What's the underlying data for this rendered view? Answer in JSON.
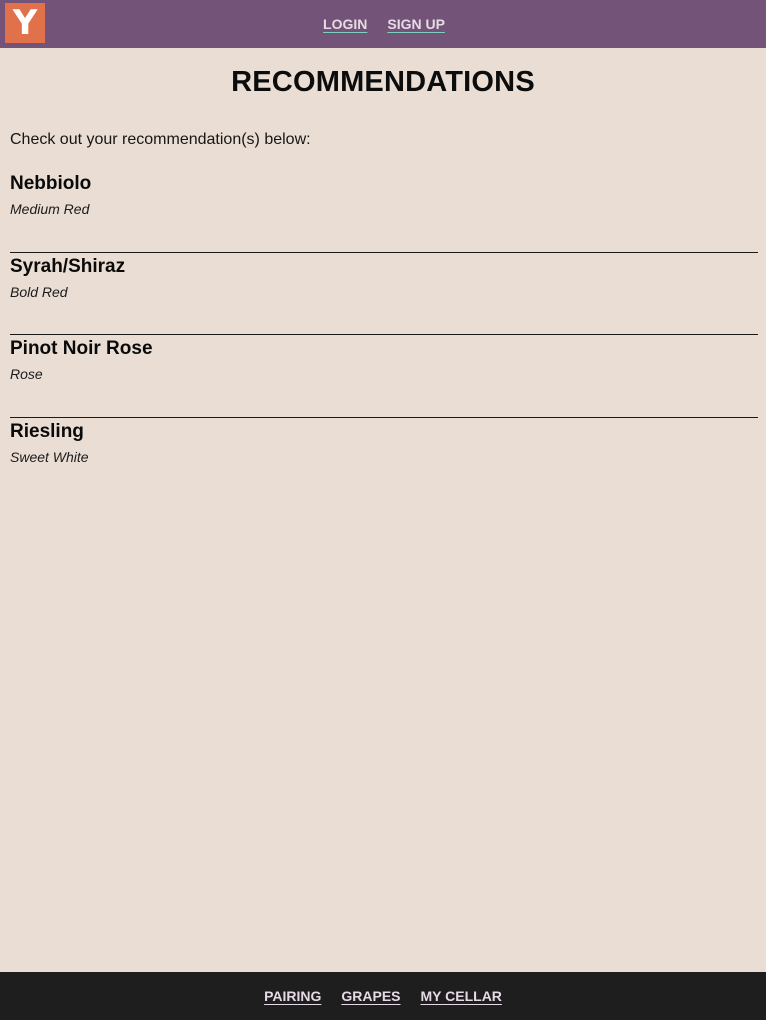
{
  "header": {
    "logo_letter": "Y",
    "nav": [
      {
        "label": "LOGIN"
      },
      {
        "label": "SIGN UP"
      }
    ]
  },
  "main": {
    "title": "RECOMMENDATIONS",
    "intro": "Check out your recommendation(s) below:",
    "recommendations": [
      {
        "name": "Nebbiolo",
        "type": "Medium Red"
      },
      {
        "name": "Syrah/Shiraz",
        "type": "Bold Red"
      },
      {
        "name": "Pinot Noir Rose",
        "type": "Rose"
      },
      {
        "name": "Riesling",
        "type": "Sweet White"
      }
    ]
  },
  "footer": {
    "nav": [
      {
        "label": "PAIRING"
      },
      {
        "label": "GRAPES"
      },
      {
        "label": "MY CELLAR"
      }
    ]
  },
  "colors": {
    "header_bg": "#735478",
    "logo_bg": "#e0714a",
    "page_bg": "#e9ddd4",
    "footer_bg": "#1e1e1e",
    "link_underline_accent": "#7fcfc1"
  }
}
